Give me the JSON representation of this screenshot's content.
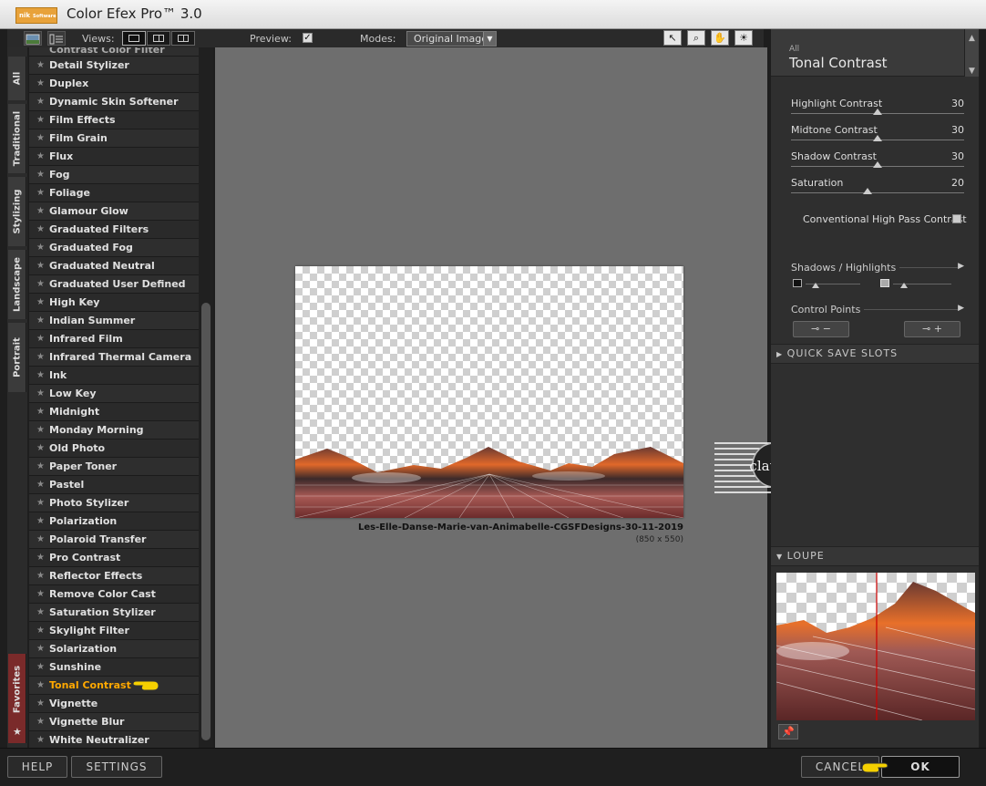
{
  "app": {
    "title": "Color Efex Pro™ 3.0",
    "logo_text": "nik",
    "logo_sub": "Software"
  },
  "toolbar": {
    "views_label": "Views:",
    "preview_label": "Preview:",
    "preview_checked": true,
    "preview_check_glyph": "✓",
    "modes_label": "Modes:",
    "modes_value": "Original Image",
    "tools": [
      {
        "icon": "arrow-pointer-icon",
        "glyph": "↖"
      },
      {
        "icon": "zoom-icon",
        "glyph": "⌕"
      },
      {
        "icon": "hand-icon",
        "glyph": "✋"
      },
      {
        "icon": "lightbulb-icon",
        "glyph": "☀"
      }
    ]
  },
  "side_tabs": [
    "All",
    "Traditional",
    "Stylizing",
    "Landscape",
    "Portrait",
    "Favorites"
  ],
  "filters": {
    "partial_top": "Contrast Color Filter",
    "items": [
      "Detail Stylizer",
      "Duplex",
      "Dynamic Skin Softener",
      "Film Effects",
      "Film Grain",
      "Flux",
      "Fog",
      "Foliage",
      "Glamour Glow",
      "Graduated Filters",
      "Graduated Fog",
      "Graduated Neutral Density",
      "Graduated User Defined",
      "High Key",
      "Indian Summer",
      "Infrared Film",
      "Infrared Thermal Camera",
      "Ink",
      "Low Key",
      "Midnight",
      "Monday Morning",
      "Old Photo",
      "Paper Toner",
      "Pastel",
      "Photo Stylizer",
      "Polarization",
      "Polaroid Transfer",
      "Pro Contrast",
      "Reflector Effects",
      "Remove Color Cast",
      "Saturation Stylizer",
      "Skylight Filter",
      "Solarization",
      "Sunshine",
      "Tonal Contrast",
      "Vignette",
      "Vignette Blur",
      "White Neutralizer"
    ],
    "selected": "Tonal Contrast"
  },
  "canvas": {
    "file_name": "Les-Elle-Danse-Marie-van-Animabelle-CGSFDesigns-30-11-2019",
    "file_size": "(850 x 550)",
    "watermark_text": "claudia"
  },
  "panel": {
    "category": "All",
    "title": "Tonal Contrast",
    "sliders": [
      {
        "label": "Highlight Contrast",
        "value": "30",
        "level": 0.5
      },
      {
        "label": "Midtone Contrast",
        "value": "30",
        "level": 0.5
      },
      {
        "label": "Shadow Contrast",
        "value": "30",
        "level": 0.5
      },
      {
        "label": "Saturation",
        "value": "20",
        "level": 0.44
      }
    ],
    "checkbox_label": "Conventional High Pass Contrast",
    "checkbox_checked": false,
    "shadows_highlights": "Shadows / Highlights",
    "control_points": "Control Points",
    "cp_remove_glyph": "−",
    "cp_add_glyph": "+",
    "quick_save": "QUICK SAVE SLOTS",
    "loupe": "LOUPE",
    "loupe_pin_glyph": "📌"
  },
  "bottom": {
    "help": "HELP",
    "settings": "SETTINGS",
    "cancel": "CANCEL",
    "ok": "OK"
  },
  "colors": {
    "selected_text": "#ffa800",
    "favorites_tab": "#7a2a2a",
    "loupe_crosshair": "#cc0000"
  }
}
